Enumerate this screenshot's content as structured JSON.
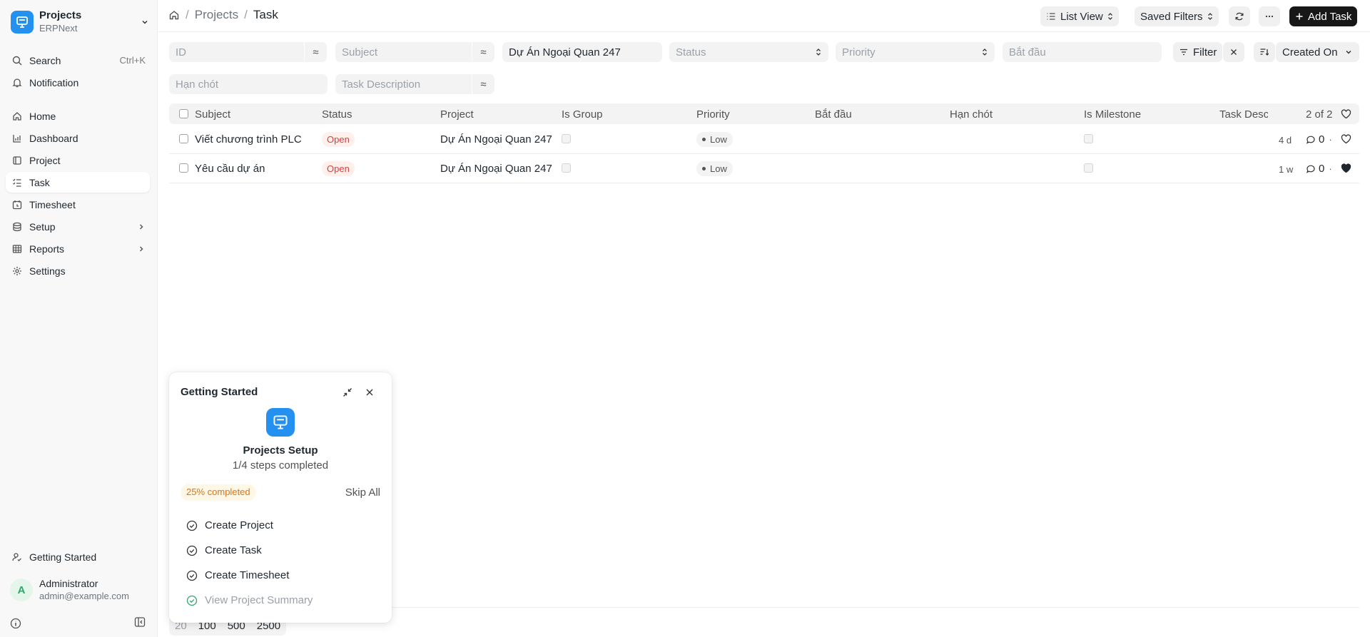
{
  "app": {
    "title": "Projects",
    "subtitle": "ERPNext"
  },
  "sidebar": {
    "search_label": "Search",
    "search_shortcut": "Ctrl+K",
    "notification_label": "Notification",
    "items": [
      {
        "label": "Home",
        "icon": "home-icon"
      },
      {
        "label": "Dashboard",
        "icon": "dashboard-icon"
      },
      {
        "label": "Project",
        "icon": "project-icon"
      },
      {
        "label": "Task",
        "icon": "task-icon",
        "active": true
      },
      {
        "label": "Timesheet",
        "icon": "timesheet-icon"
      },
      {
        "label": "Setup",
        "icon": "database-icon",
        "has_children": true
      },
      {
        "label": "Reports",
        "icon": "table-icon",
        "has_children": true
      },
      {
        "label": "Settings",
        "icon": "gear-icon"
      }
    ],
    "getting_started_label": "Getting Started",
    "user": {
      "initial": "A",
      "name": "Administrator",
      "email": "admin@example.com"
    }
  },
  "header": {
    "breadcrumb": [
      "Projects",
      "Task"
    ],
    "list_view_label": "List View",
    "saved_filters_label": "Saved Filters",
    "add_task_label": "Add Task"
  },
  "filters": {
    "id_placeholder": "ID",
    "subject_placeholder": "Subject",
    "project_value": "Dự Án Ngoại Quan 247",
    "status_placeholder": "Status",
    "priority_placeholder": "Priority",
    "start_placeholder": "Bắt đầu",
    "end_placeholder": "Hạn chót",
    "task_description_placeholder": "Task Description",
    "filter_label": "Filter",
    "sort_label": "Created On",
    "approx_symbol": "≈"
  },
  "table": {
    "columns": [
      "Subject",
      "Status",
      "Project",
      "Is Group",
      "Priority",
      "Bắt đầu",
      "Hạn chót",
      "Is Milestone",
      "Task Desc"
    ],
    "count_label": "2 of 2",
    "rows": [
      {
        "subject": "Viết chương trình PLC",
        "status": "Open",
        "project": "Dự Án Ngoại Quan 247",
        "priority": "Low",
        "age": "4 d",
        "comments": "0",
        "liked": false
      },
      {
        "subject": "Yêu cầu dự án",
        "status": "Open",
        "project": "Dự Án Ngoại Quan 247",
        "priority": "Low",
        "age": "1 w",
        "comments": "0",
        "liked": true
      }
    ]
  },
  "pager": {
    "sizes": [
      "20",
      "100",
      "500",
      "2500"
    ]
  },
  "getting_started": {
    "title": "Getting Started",
    "heading": "Projects Setup",
    "progress_text": "1/4 steps completed",
    "badge": "25% completed",
    "progress": 0.25,
    "skip_label": "Skip All",
    "steps": [
      {
        "label": "Create Project",
        "done": false
      },
      {
        "label": "Create Task",
        "done": false
      },
      {
        "label": "Create Timesheet",
        "done": false
      },
      {
        "label": "View Project Summary",
        "done": true
      }
    ]
  },
  "colors": {
    "accent": "#2490ef",
    "primary_button": "#171717",
    "open_pill_text": "#d14343",
    "badge_text": "#d4761d",
    "done_check": "#30a66d"
  }
}
